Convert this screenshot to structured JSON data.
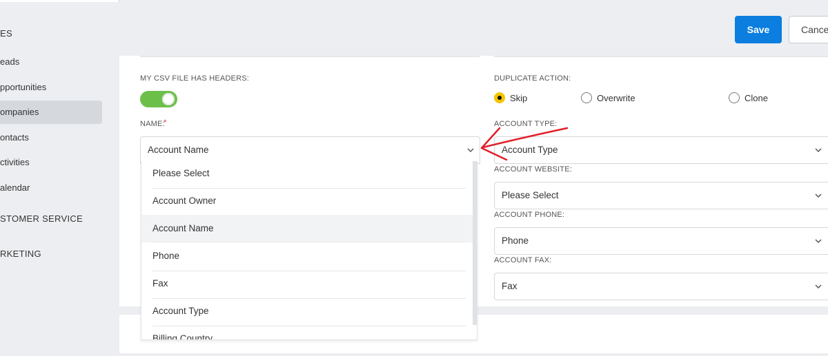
{
  "sidebar": {
    "sections": [
      {
        "label": "ES"
      },
      {
        "label": "STOMER SERVICE"
      },
      {
        "label": "RKETING"
      }
    ],
    "items": [
      {
        "label": "eads"
      },
      {
        "label": "pportunities"
      },
      {
        "label": "ompanies",
        "active": true
      },
      {
        "label": "ontacts"
      },
      {
        "label": "ctivities"
      },
      {
        "label": "alendar"
      }
    ]
  },
  "toolbar": {
    "save_label": "Save",
    "cancel_label": "Cance"
  },
  "form": {
    "csv_headers_label": "MY CSV FILE HAS HEADERS:",
    "csv_headers_on": true,
    "duplicate_action_label": "DUPLICATE ACTION:",
    "duplicate_options": [
      {
        "label": "Skip",
        "checked": true
      },
      {
        "label": "Overwrite",
        "checked": false
      },
      {
        "label": "Clone",
        "checked": false
      }
    ],
    "name_label": "NAME:",
    "name_required_mark": "*",
    "name_value": "Account Name",
    "account_type_label": "ACCOUNT TYPE:",
    "account_type_value": "Account Type",
    "account_website_label": "ACCOUNT WEBSITE:",
    "account_website_value": "Please Select",
    "account_phone_label": "ACCOUNT PHONE:",
    "account_phone_value": "Phone",
    "account_fax_label": "ACCOUNT FAX:",
    "account_fax_value": "Fax"
  },
  "dropdown": {
    "options": [
      {
        "label": "Please Select"
      },
      {
        "label": "Account Owner"
      },
      {
        "label": "Account Name",
        "active": true
      },
      {
        "label": "Phone"
      },
      {
        "label": "Fax"
      },
      {
        "label": "Account Type"
      },
      {
        "label": "Billing Country"
      }
    ]
  },
  "colors": {
    "accent": "#0b7ee0",
    "toggle_on": "#6cc04a",
    "radio_checked": "#f5c400",
    "annotation": "#e0202a"
  },
  "icons": {
    "chevron": "chevron-down-icon",
    "annotation": "red-arrow-icon"
  }
}
